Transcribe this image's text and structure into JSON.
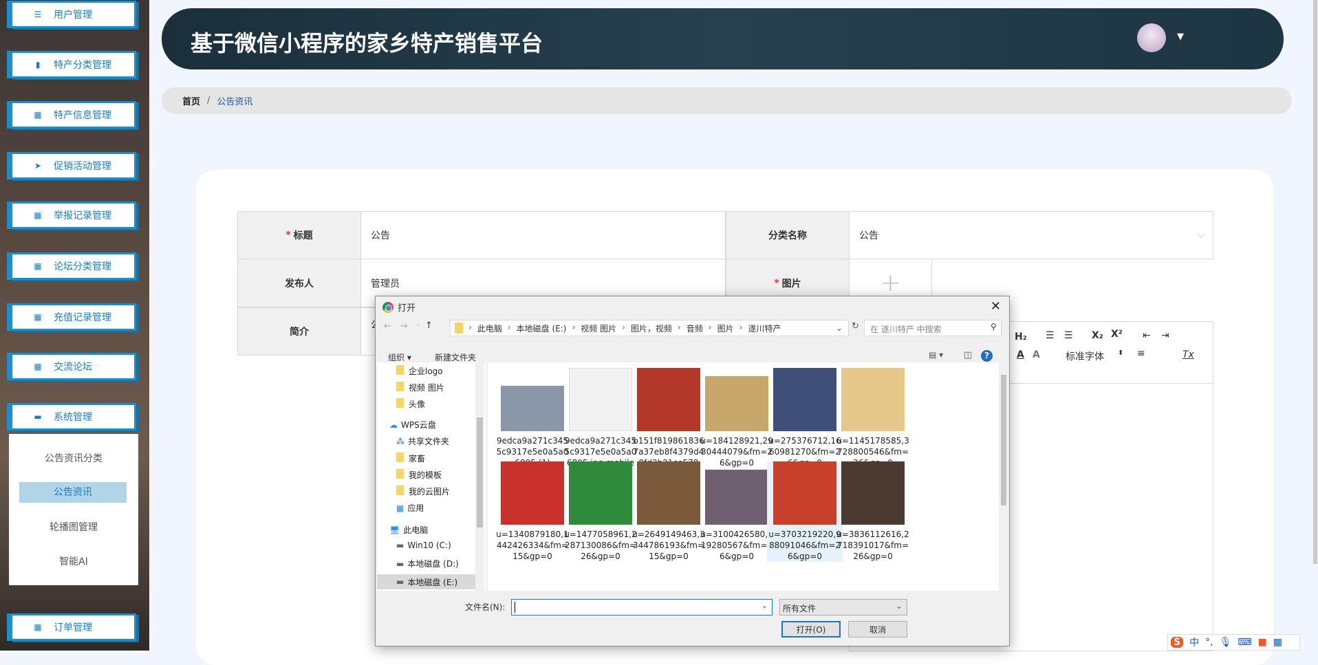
{
  "sidebar": {
    "items": [
      {
        "label": "用户管理",
        "icon": "list-icon"
      },
      {
        "label": "特产分类管理",
        "icon": "bar-chart-icon"
      },
      {
        "label": "特产信息管理",
        "icon": "grid-icon"
      },
      {
        "label": "促销活动管理",
        "icon": "paper-plane-icon"
      },
      {
        "label": "举报记录管理",
        "icon": "grid-icon"
      },
      {
        "label": "论坛分类管理",
        "icon": "grid-icon"
      },
      {
        "label": "充值记录管理",
        "icon": "grid-icon"
      },
      {
        "label": "交流论坛",
        "icon": "grid-icon"
      },
      {
        "label": "系统管理",
        "icon": "monitor-icon"
      }
    ],
    "submenu": [
      "公告资讯分类",
      "公告资讯",
      "轮播图管理",
      "智能AI"
    ],
    "order": "订单管理"
  },
  "header": {
    "title": "基于微信小程序的家乡特产销售平台"
  },
  "breadcrumb": {
    "home": "首页",
    "sep": "/",
    "current": "公告资讯"
  },
  "form": {
    "title_label": "标题",
    "title_value": "公告",
    "category_label": "分类名称",
    "category_value": "公告",
    "publisher_label": "发布人",
    "publisher_value": "管理员",
    "image_label": "图片",
    "intro_label": "简介",
    "intro_value": "公",
    "font_select": "标准字体"
  },
  "dialog": {
    "title": "打开",
    "path": [
      "此电脑",
      "本地磁盘 (E:)",
      "视频 图片",
      "图片，视频",
      "音频",
      "图片",
      "遂川特产"
    ],
    "search_placeholder": "在 遂川特产 中搜索",
    "organize": "组织 ▾",
    "new_folder": "新建文件夹",
    "nav": [
      "企业logo",
      "视频 图片",
      "头像",
      "WPS云盘",
      "共享文件夹",
      "家畜",
      "我的模板",
      "我的云图片",
      "应用",
      "此电脑",
      "Win10 (C:)",
      "本地磁盘 (D:)",
      "本地磁盘 (E:)"
    ],
    "files": [
      {
        "name": "9edca9a271c3455c9317e5e0a5a06895 (1)",
        "color": "#8a97a8"
      },
      {
        "name": "9edca9a271c3455c9317e5e0a5a06895.jpg-mobile",
        "color": "#f2f2f2"
      },
      {
        "name": "b151f8198618367a37eb8f4379d48fd2b21ce578",
        "color": "#b3382a"
      },
      {
        "name": "u=184128921,2930444079&fm=26&gp=0",
        "color": "#c8a86a"
      },
      {
        "name": "u=275376712,1660981270&fm=26&gp=0",
        "color": "#3f4f7a"
      },
      {
        "name": "u=1145178585,3728800546&fm=26&gp=0",
        "color": "#e6c98a"
      },
      {
        "name": "u=1340879180,1442426334&fm=15&gp=0",
        "color": "#c8312c"
      },
      {
        "name": "u=1477058961,2287130086&fm=26&gp=0",
        "color": "#2f8a3c"
      },
      {
        "name": "u=2649149463,3344786193&fm=15&gp=0",
        "color": "#7a5a3a"
      },
      {
        "name": "u=3100426580,519280567&fm=26&gp=0",
        "color": "#6e6070"
      },
      {
        "name": "u=3703219220,988091046&fm=26&gp=0",
        "color": "#c8402a"
      },
      {
        "name": "u=3836112616,2718391017&fm=26&gp=0",
        "color": "#4a3a30"
      }
    ],
    "filename_label": "文件名(N):",
    "filename_value": "",
    "filter": "所有文件",
    "open": "打开(O)",
    "cancel": "取消"
  },
  "ime": {
    "mode": "中",
    "punct": "°,"
  }
}
